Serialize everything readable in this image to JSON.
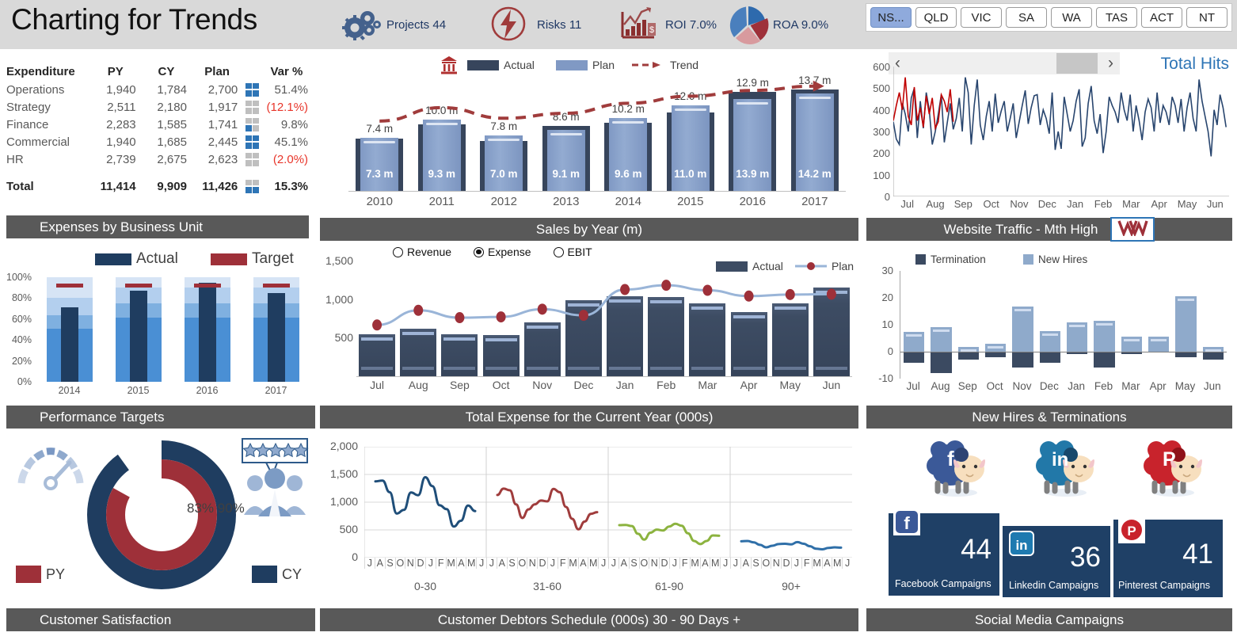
{
  "header": {
    "title": "Charting for Trends",
    "kpis": [
      {
        "icon": "gears-icon",
        "label": "Projects 44"
      },
      {
        "icon": "risk-bolt-icon",
        "label": "Risks 11"
      },
      {
        "icon": "roi-chart-icon",
        "label": "ROI 7.0%"
      },
      {
        "icon": "roa-pie-icon",
        "label": "ROA 9.0%"
      }
    ],
    "state_tabs": [
      {
        "label": "NS...",
        "active": true
      },
      {
        "label": "QLD",
        "active": false
      },
      {
        "label": "VIC",
        "active": false
      },
      {
        "label": "SA",
        "active": false
      },
      {
        "label": "WA",
        "active": false
      },
      {
        "label": "TAS",
        "active": false
      },
      {
        "label": "ACT",
        "active": false
      },
      {
        "label": "NT",
        "active": false
      }
    ]
  },
  "expenditure": {
    "panel_title": "Expenses by Business Unit",
    "columns": [
      "Expenditure",
      "PY",
      "CY",
      "Plan",
      "Var %"
    ],
    "rows": [
      {
        "name": "Operations",
        "py": "1,940",
        "cy": "1,784",
        "plan": "2,700",
        "var": "51.4%",
        "negative": false,
        "quads": [
          1,
          1,
          1,
          1
        ]
      },
      {
        "name": "Strategy",
        "py": "2,511",
        "cy": "2,180",
        "plan": "1,917",
        "var": "(12.1%)",
        "negative": true,
        "quads": [
          0,
          0,
          0,
          0
        ]
      },
      {
        "name": "Finance",
        "py": "2,283",
        "cy": "1,585",
        "plan": "1,741",
        "var": "9.8%",
        "negative": false,
        "quads": [
          0,
          0,
          1,
          0
        ]
      },
      {
        "name": "Commercial",
        "py": "1,940",
        "cy": "1,685",
        "plan": "2,445",
        "var": "45.1%",
        "negative": false,
        "quads": [
          1,
          1,
          1,
          1
        ]
      },
      {
        "name": "HR",
        "py": "2,739",
        "cy": "2,675",
        "plan": "2,623",
        "var": "(2.0%)",
        "negative": true,
        "quads": [
          0,
          0,
          0,
          0
        ]
      }
    ],
    "total": {
      "name": "Total",
      "py": "11,414",
      "cy": "9,909",
      "plan": "11,426",
      "var": "15.3%",
      "negative": false,
      "quads": [
        0,
        0,
        1,
        1
      ]
    }
  },
  "sales_by_year": {
    "panel_title": "Sales by Year (m)",
    "bank_icon": "bank-icon",
    "legend": [
      {
        "label": "Actual",
        "color": "#37455c",
        "type": "swatch"
      },
      {
        "label": "Plan",
        "color": "#8099c4",
        "type": "swatch"
      },
      {
        "label": "Trend",
        "color": "#a03c3c",
        "type": "dashed-arrow"
      }
    ],
    "chart_data": {
      "type": "bar",
      "title": "Sales by Year (m)",
      "xlabel": "",
      "ylabel": "m",
      "ylim": [
        0,
        16
      ],
      "categories": [
        "2010",
        "2011",
        "2012",
        "2013",
        "2014",
        "2015",
        "2016",
        "2017"
      ],
      "series": [
        {
          "name": "Actual",
          "values": [
            7.3,
            9.3,
            7.0,
            9.1,
            9.6,
            11.0,
            13.9,
            14.2
          ],
          "labels": [
            "7.3 m",
            "9.3 m",
            "7.0 m",
            "9.1 m",
            "9.6 m",
            "11.0 m",
            "13.9 m",
            "14.2 m"
          ]
        },
        {
          "name": "Plan",
          "values": [
            7.4,
            10.0,
            7.8,
            8.6,
            10.2,
            12.0,
            12.9,
            13.7
          ],
          "labels": [
            "7.4 m",
            "10.0 m",
            "7.8 m",
            "8.6 m",
            "10.2 m",
            "12.0 m",
            "12.9 m",
            "13.7 m"
          ]
        },
        {
          "name": "Trend",
          "values": [
            9.9,
            11.8,
            10.3,
            11.0,
            12.4,
            13.4,
            14.2,
            14.8
          ]
        }
      ]
    }
  },
  "website_traffic": {
    "panel_title": "Website Traffic - Mth High",
    "logo_text": "W",
    "series_label": "Total Hits",
    "scrollbar": {
      "left_arrow": "‹",
      "right_arrow": "›"
    },
    "chart_data": {
      "type": "line",
      "title": "Website Traffic - Mth High",
      "ylim": [
        0,
        600
      ],
      "yticks": [
        0,
        100,
        200,
        300,
        400,
        500,
        600
      ],
      "xlabel": "",
      "ylabel": "Total Hits",
      "categories": [
        "Jul",
        "Aug",
        "Sep",
        "Oct",
        "Nov",
        "Dec",
        "Jan",
        "Feb",
        "Mar",
        "Apr",
        "May",
        "Jun"
      ],
      "series": [
        {
          "name": "Total Hits (highlight)",
          "color": "#c00000",
          "values": [
            350,
            420,
            480,
            400,
            550,
            370,
            330,
            505,
            350,
            410,
            320,
            465,
            380,
            455,
            315,
            345,
            470,
            440,
            390,
            495,
            345
          ]
        },
        {
          "name": "Total Hits",
          "color": "#28456e",
          "values": [
            345,
            265,
            240,
            430,
            380,
            300,
            455,
            500,
            270,
            440,
            315,
            480,
            400,
            240,
            300,
            380,
            470,
            250,
            340,
            430,
            310,
            360,
            455,
            300,
            550,
            480,
            240,
            420,
            540,
            330,
            260,
            370,
            440,
            300,
            475,
            340,
            395,
            440,
            300,
            360,
            430,
            270,
            345,
            420,
            490,
            335,
            410,
            465,
            470,
            330,
            400,
            360,
            290,
            480,
            215,
            300,
            220,
            460,
            380,
            300,
            350,
            440,
            495,
            230,
            270,
            430,
            510,
            350,
            290,
            380,
            200,
            300,
            460,
            420,
            390,
            340,
            480,
            400,
            350,
            470,
            300,
            420,
            350,
            260,
            390,
            450,
            410,
            300,
            480,
            340,
            420,
            390,
            330,
            460,
            420,
            340,
            450,
            300,
            410,
            480,
            360,
            300,
            540,
            440,
            370,
            300,
            185,
            400,
            330,
            470,
            410,
            320
          ]
        }
      ]
    }
  },
  "performance_targets": {
    "panel_title": "Performance Targets",
    "legend": [
      {
        "label": "Actual",
        "color": "#1f3d60"
      },
      {
        "label": "Target",
        "color": "#9e3039"
      }
    ],
    "chart_data": {
      "type": "bar",
      "title": "Performance Targets",
      "ylim": [
        0,
        1
      ],
      "yticks": [
        "0%",
        "20%",
        "40%",
        "60%",
        "80%",
        "100%"
      ],
      "categories": [
        "2014",
        "2015",
        "2016",
        "2017"
      ],
      "series": [
        {
          "name": "Actual",
          "values": [
            0.71,
            0.87,
            0.95,
            0.85
          ]
        },
        {
          "name": "Target",
          "values": [
            0.9,
            0.9,
            0.9,
            0.9
          ]
        },
        {
          "name": "Band Low",
          "values": [
            0.51,
            0.61,
            0.61,
            0.61
          ]
        },
        {
          "name": "Band Mid",
          "values": [
            0.64,
            0.75,
            0.75,
            0.75
          ]
        },
        {
          "name": "Band High",
          "values": [
            0.8,
            0.9,
            0.9,
            0.9
          ]
        }
      ]
    }
  },
  "total_expense": {
    "panel_title": "Total Expense for the Current Year (000s)",
    "radios": [
      {
        "label": "Revenue",
        "selected": false
      },
      {
        "label": "Expense",
        "selected": true
      },
      {
        "label": "EBIT",
        "selected": false
      }
    ],
    "legend": [
      {
        "label": "Actual",
        "color": "#3d4c63",
        "type": "swatch"
      },
      {
        "label": "Plan",
        "color": "#9ab5d8",
        "type": "line-marker"
      }
    ],
    "chart_data": {
      "type": "bar",
      "title": "Total Expense for the Current Year (000s)",
      "ylim": [
        0,
        1500
      ],
      "yticks": [
        500,
        1000,
        1500
      ],
      "categories": [
        "Jul",
        "Aug",
        "Sep",
        "Oct",
        "Nov",
        "Dec",
        "Jan",
        "Feb",
        "Mar",
        "Apr",
        "May",
        "Jun"
      ],
      "series": [
        {
          "name": "Actual",
          "values": [
            540,
            620,
            545,
            530,
            700,
            990,
            1040,
            1025,
            945,
            835,
            945,
            1150
          ]
        },
        {
          "name": "Plan",
          "values": [
            675,
            865,
            770,
            780,
            880,
            800,
            1135,
            1190,
            1125,
            1050,
            1070,
            1075
          ]
        }
      ]
    }
  },
  "new_hires": {
    "panel_title": "New Hires & Terminations",
    "legend": [
      {
        "label": "Termination",
        "color": "#3b4a61"
      },
      {
        "label": "New Hires",
        "color": "#8faacb"
      }
    ],
    "chart_data": {
      "type": "bar",
      "title": "New Hires & Terminations",
      "ylim": [
        -10,
        30
      ],
      "yticks": [
        -10,
        0,
        10,
        20,
        30
      ],
      "categories": [
        "Jul",
        "Aug",
        "Sep",
        "Oct",
        "Nov",
        "Dec",
        "Jan",
        "Feb",
        "Mar",
        "Apr",
        "May",
        "Jun"
      ],
      "series": [
        {
          "name": "New Hires",
          "values": [
            7.5,
            9,
            1.7,
            2.8,
            16.8,
            7.6,
            10.8,
            11.6,
            5.6,
            5.7,
            20.7,
            1.7
          ]
        },
        {
          "name": "Termination",
          "values": [
            -4,
            -8,
            -3,
            -2,
            -6,
            -4,
            -1,
            -6,
            -1,
            0,
            -2,
            -3
          ]
        }
      ]
    }
  },
  "customer_satisfaction": {
    "panel_title": "Customer Satisfaction",
    "value_labels": "83% 90%",
    "gauge_icon": "gauge-icon",
    "rating_icon": "five-star-people-icon",
    "legend": [
      {
        "label": "PY",
        "color": "#9e3039"
      },
      {
        "label": "CY",
        "color": "#1f3d60"
      }
    ],
    "chart_data": {
      "type": "pie",
      "title": "Customer Satisfaction",
      "series": [
        {
          "name": "CY",
          "value": 90,
          "label": "90%",
          "color": "#1f3d60"
        },
        {
          "name": "PY",
          "value": 83,
          "label": "83%",
          "color": "#9e3039"
        }
      ]
    }
  },
  "debtors": {
    "panel_title": "Customer Debtors Schedule (000s)  30 - 90 Days +",
    "chart_data": {
      "type": "line",
      "title": "Customer Debtors Schedule (000s)  30 - 90 Days +",
      "ylim": [
        0,
        2000
      ],
      "yticks": [
        "0",
        "500",
        "1,000",
        "1,500",
        "2,000"
      ],
      "month_ticks": [
        "J",
        "A",
        "S",
        "O",
        "N",
        "D",
        "J",
        "F",
        "M",
        "A",
        "M",
        "J"
      ],
      "panels": [
        "0-30",
        "31-60",
        "61-90",
        "90+"
      ],
      "series": [
        {
          "name": "0-30",
          "color": "#1f4e79",
          "values": [
            1375,
            1390,
            1180,
            795,
            860,
            1175,
            1125,
            1450,
            1290,
            945,
            875,
            560,
            665,
            940,
            840
          ]
        },
        {
          "name": "31-60",
          "color": "#a03c3c",
          "values": [
            1130,
            1245,
            1215,
            960,
            715,
            870,
            960,
            1030,
            1015,
            1240,
            1180,
            915,
            700,
            510,
            650,
            790,
            820
          ]
        },
        {
          "name": "61-90",
          "color": "#8cb33f",
          "values": [
            585,
            590,
            570,
            430,
            325,
            450,
            505,
            490,
            560,
            610,
            575,
            440,
            300,
            245,
            300,
            400,
            395
          ]
        },
        {
          "name": "90+",
          "color": "#2f6fa8",
          "values": [
            295,
            300,
            275,
            230,
            185,
            215,
            245,
            250,
            240,
            280,
            250,
            205,
            160,
            150,
            175,
            185,
            180
          ]
        }
      ]
    }
  },
  "social_media": {
    "panel_title": "Social  Media Campaigns",
    "tiles": [
      {
        "platform": "facebook",
        "icon": "facebook-icon",
        "count": "44",
        "caption": "Facebook Campaigns",
        "color": "#3b5998"
      },
      {
        "platform": "linkedin",
        "icon": "linkedin-icon",
        "count": "36",
        "caption": "Linkedin Campaigns",
        "color": "#0077b5"
      },
      {
        "platform": "pinterest",
        "icon": "pinterest-icon",
        "count": "41",
        "caption": "Pinterest  Campaigns",
        "color": "#c8232c"
      }
    ],
    "mascots": [
      {
        "platform": "facebook",
        "icon": "facebook-sheep-icon"
      },
      {
        "platform": "linkedin",
        "icon": "linkedin-sheep-icon"
      },
      {
        "platform": "pinterest",
        "icon": "pinterest-sheep-icon"
      }
    ]
  }
}
